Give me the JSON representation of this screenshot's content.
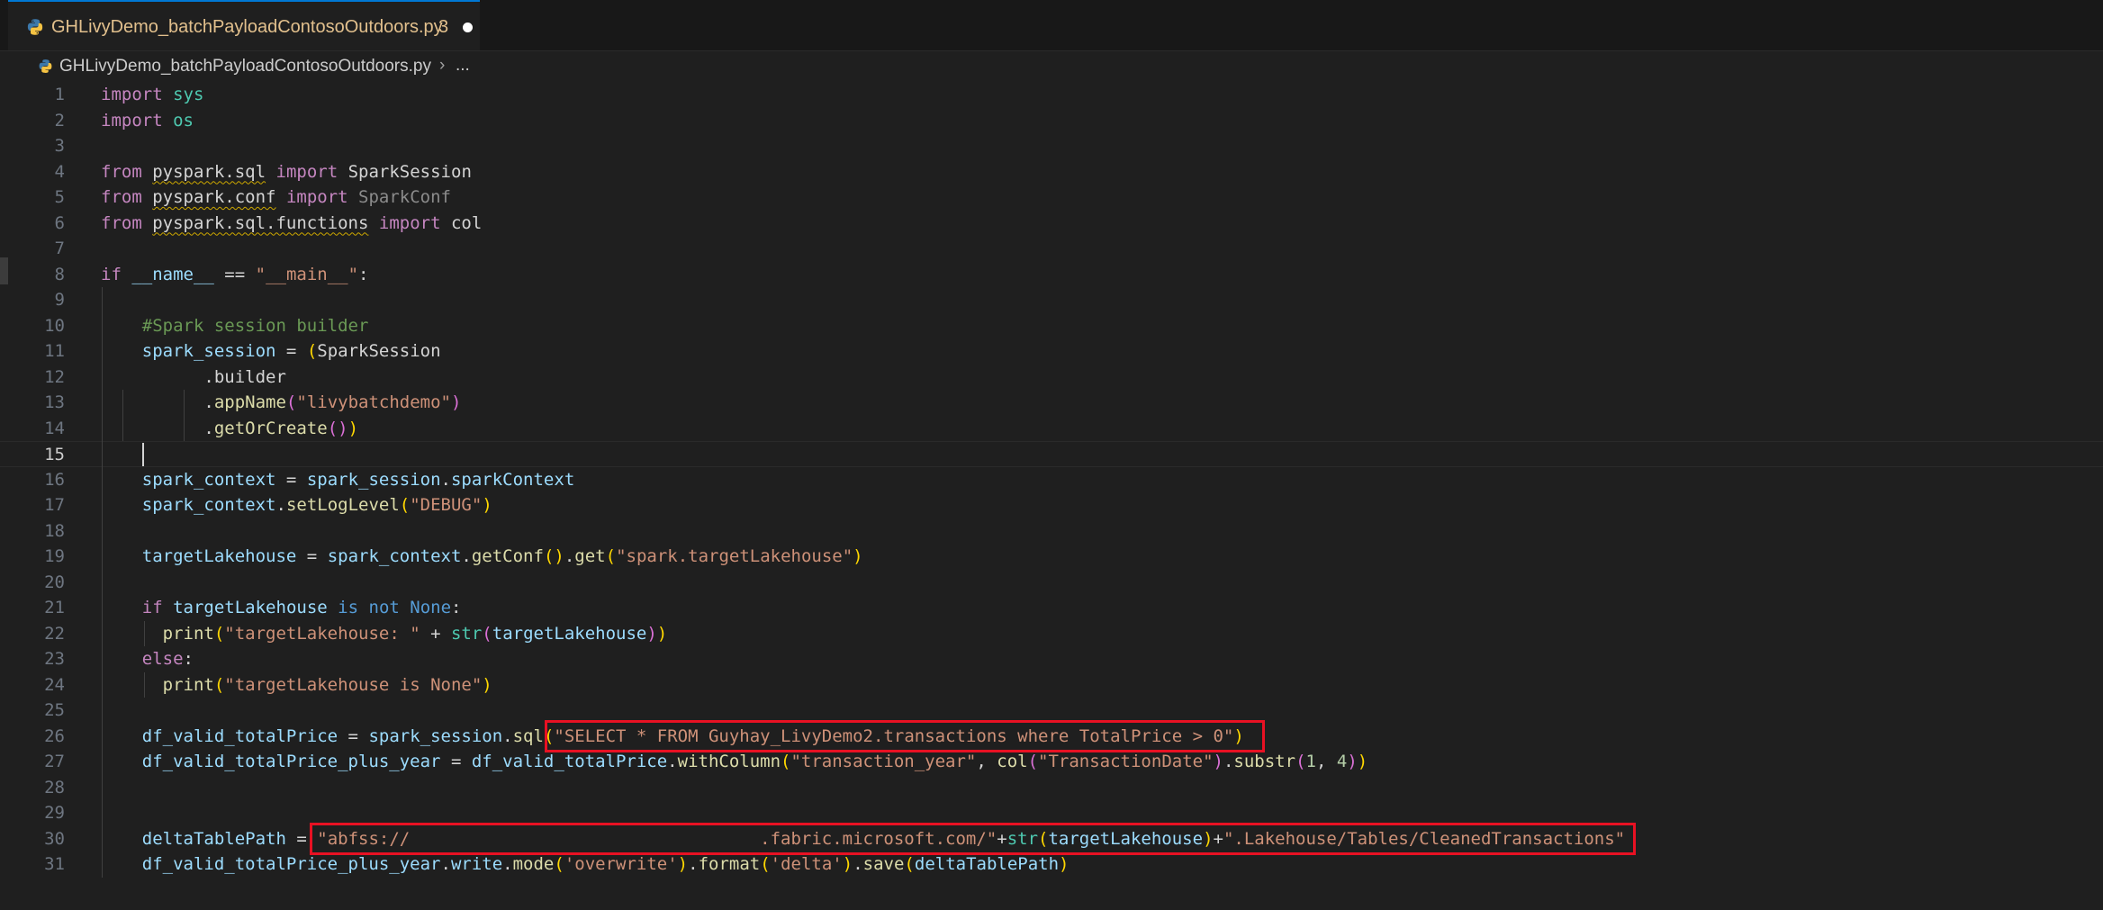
{
  "tab": {
    "filename": "GHLivyDemo_batchPayloadContosoOutdoors.py",
    "problem_count": "3",
    "state": "unsaved"
  },
  "breadcrumb": {
    "file": "GHLivyDemo_batchPayloadContosoOutdoors.py",
    "separator": "›",
    "more": "..."
  },
  "editor": {
    "current_line": 15,
    "line_numbers": [
      "1",
      "2",
      "3",
      "4",
      "5",
      "6",
      "7",
      "8",
      "9",
      "10",
      "11",
      "12",
      "13",
      "14",
      "15",
      "16",
      "17",
      "18",
      "19",
      "20",
      "21",
      "22",
      "23",
      "24",
      "25",
      "26",
      "27",
      "28",
      "29",
      "30",
      "31"
    ],
    "lines": [
      [
        [
          "kw",
          "import"
        ],
        [
          "txt",
          " "
        ],
        [
          "cls",
          "sys"
        ]
      ],
      [
        [
          "kw",
          "import"
        ],
        [
          "txt",
          " "
        ],
        [
          "cls",
          "os"
        ]
      ],
      [],
      [
        [
          "kw",
          "from"
        ],
        [
          "txt",
          " "
        ],
        [
          "mod squig",
          "pyspark.sql"
        ],
        [
          "txt",
          " "
        ],
        [
          "kw",
          "import"
        ],
        [
          "txt",
          " "
        ],
        [
          "txt",
          "SparkSession"
        ]
      ],
      [
        [
          "kw",
          "from"
        ],
        [
          "txt",
          " "
        ],
        [
          "mod squig",
          "pyspark.conf"
        ],
        [
          "txt",
          " "
        ],
        [
          "kw",
          "import"
        ],
        [
          "txt",
          " "
        ],
        [
          "dim",
          "SparkConf"
        ]
      ],
      [
        [
          "kw",
          "from"
        ],
        [
          "txt",
          " "
        ],
        [
          "mod squig",
          "pyspark.sql.functions"
        ],
        [
          "txt",
          " "
        ],
        [
          "kw",
          "import"
        ],
        [
          "txt",
          " "
        ],
        [
          "txt",
          "col"
        ]
      ],
      [],
      [
        [
          "ctl",
          "if"
        ],
        [
          "txt",
          " "
        ],
        [
          "var",
          "__name__"
        ],
        [
          "txt",
          " == "
        ],
        [
          "str",
          "\"__main__\""
        ],
        [
          "txt",
          ":"
        ]
      ],
      [],
      [
        [
          "txt",
          "    "
        ],
        [
          "cmt",
          "#Spark session builder"
        ]
      ],
      [
        [
          "txt",
          "    "
        ],
        [
          "var",
          "spark_session"
        ],
        [
          "txt",
          " = "
        ],
        [
          "p1",
          "("
        ],
        [
          "txt",
          "SparkSession"
        ]
      ],
      [
        [
          "txt",
          "          .builder"
        ]
      ],
      [
        [
          "txt",
          "          ."
        ],
        [
          "fn",
          "appName"
        ],
        [
          "p2",
          "("
        ],
        [
          "str",
          "\"livybatchdemo\""
        ],
        [
          "p2",
          ")"
        ]
      ],
      [
        [
          "txt",
          "          ."
        ],
        [
          "fn",
          "getOrCreate"
        ],
        [
          "p2",
          "()"
        ],
        [
          "p1",
          ")"
        ]
      ],
      [],
      [
        [
          "txt",
          "    "
        ],
        [
          "var",
          "spark_context"
        ],
        [
          "txt",
          " = "
        ],
        [
          "var",
          "spark_session"
        ],
        [
          "txt",
          "."
        ],
        [
          "var",
          "sparkContext"
        ]
      ],
      [
        [
          "txt",
          "    "
        ],
        [
          "var",
          "spark_context"
        ],
        [
          "txt",
          "."
        ],
        [
          "fn",
          "setLogLevel"
        ],
        [
          "p1",
          "("
        ],
        [
          "str",
          "\"DEBUG\""
        ],
        [
          "p1",
          ")"
        ]
      ],
      [],
      [
        [
          "txt",
          "    "
        ],
        [
          "var",
          "targetLakehouse"
        ],
        [
          "txt",
          " = "
        ],
        [
          "var",
          "spark_context"
        ],
        [
          "txt",
          "."
        ],
        [
          "fn",
          "getConf"
        ],
        [
          "p1",
          "()"
        ],
        [
          "txt",
          "."
        ],
        [
          "fn",
          "get"
        ],
        [
          "p1",
          "("
        ],
        [
          "str",
          "\"spark.targetLakehouse\""
        ],
        [
          "p1",
          ")"
        ]
      ],
      [],
      [
        [
          "txt",
          "    "
        ],
        [
          "ctl",
          "if"
        ],
        [
          "txt",
          " "
        ],
        [
          "var",
          "targetLakehouse"
        ],
        [
          "txt",
          " "
        ],
        [
          "blue",
          "is"
        ],
        [
          "txt",
          " "
        ],
        [
          "blue",
          "not"
        ],
        [
          "txt",
          " "
        ],
        [
          "blue",
          "None"
        ],
        [
          "txt",
          ":"
        ]
      ],
      [
        [
          "txt",
          "      "
        ],
        [
          "fn",
          "print"
        ],
        [
          "p1",
          "("
        ],
        [
          "str",
          "\"targetLakehouse: \""
        ],
        [
          "txt",
          " + "
        ],
        [
          "cls",
          "str"
        ],
        [
          "p2",
          "("
        ],
        [
          "var",
          "targetLakehouse"
        ],
        [
          "p2",
          ")"
        ],
        [
          "p1",
          ")"
        ]
      ],
      [
        [
          "txt",
          "    "
        ],
        [
          "ctl",
          "else"
        ],
        [
          "txt",
          ":"
        ]
      ],
      [
        [
          "txt",
          "      "
        ],
        [
          "fn",
          "print"
        ],
        [
          "p1",
          "("
        ],
        [
          "str",
          "\"targetLakehouse is None\""
        ],
        [
          "p1",
          ")"
        ]
      ],
      [],
      [
        [
          "txt",
          "    "
        ],
        [
          "var",
          "df_valid_totalPrice"
        ],
        [
          "txt",
          " = "
        ],
        [
          "var",
          "spark_session"
        ],
        [
          "txt",
          "."
        ],
        [
          "fn",
          "sql"
        ],
        [
          "p1",
          "("
        ],
        [
          "str",
          "\"SELECT * FROM Guyhay_LivyDemo2.transactions where TotalPrice > 0\""
        ],
        [
          "p1",
          ")"
        ]
      ],
      [
        [
          "txt",
          "    "
        ],
        [
          "var",
          "df_valid_totalPrice_plus_year"
        ],
        [
          "txt",
          " = "
        ],
        [
          "var",
          "df_valid_totalPrice"
        ],
        [
          "txt",
          "."
        ],
        [
          "fn",
          "withColumn"
        ],
        [
          "p1",
          "("
        ],
        [
          "str",
          "\"transaction_year\""
        ],
        [
          "txt",
          ", "
        ],
        [
          "fn",
          "col"
        ],
        [
          "p2",
          "("
        ],
        [
          "str",
          "\"TransactionDate\""
        ],
        [
          "p2",
          ")"
        ],
        [
          "txt",
          "."
        ],
        [
          "fn",
          "substr"
        ],
        [
          "p2",
          "("
        ],
        [
          "num",
          "1"
        ],
        [
          "txt",
          ", "
        ],
        [
          "num",
          "4"
        ],
        [
          "p2",
          ")"
        ],
        [
          "p1",
          ")"
        ]
      ],
      [],
      [],
      [
        [
          "txt",
          "    "
        ],
        [
          "var",
          "deltaTablePath"
        ],
        [
          "txt",
          " = "
        ],
        [
          "str",
          "\"abfss://                                  .fabric.microsoft.com/\""
        ],
        [
          "txt",
          "+"
        ],
        [
          "cls",
          "str"
        ],
        [
          "p1",
          "("
        ],
        [
          "var",
          "targetLakehouse"
        ],
        [
          "p1",
          ")"
        ],
        [
          "txt",
          "+"
        ],
        [
          "str",
          "\".Lakehouse/Tables/CleanedTransactions\""
        ]
      ],
      [
        [
          "txt",
          "    "
        ],
        [
          "var",
          "df_valid_totalPrice_plus_year"
        ],
        [
          "txt",
          "."
        ],
        [
          "var",
          "write"
        ],
        [
          "txt",
          "."
        ],
        [
          "fn",
          "mode"
        ],
        [
          "p1",
          "("
        ],
        [
          "str",
          "'overwrite'"
        ],
        [
          "p1",
          ")"
        ],
        [
          "txt",
          "."
        ],
        [
          "fn",
          "format"
        ],
        [
          "p1",
          "("
        ],
        [
          "str",
          "'delta'"
        ],
        [
          "p1",
          ")"
        ],
        [
          "txt",
          "."
        ],
        [
          "fn",
          "save"
        ],
        [
          "p1",
          "("
        ],
        [
          "var",
          "deltaTablePath"
        ],
        [
          "p1",
          ")"
        ]
      ]
    ]
  },
  "highlights": [
    "sql-query-highlight",
    "abfss-path-highlight"
  ]
}
